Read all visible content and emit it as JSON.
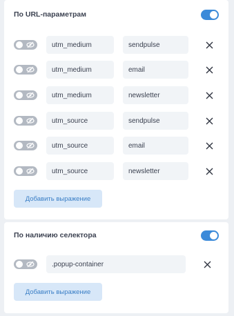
{
  "url_section": {
    "title": "По URL-параметрам",
    "enabled": true,
    "rules": [
      {
        "key": "utm_medium",
        "value": "sendpulse",
        "enabled": false
      },
      {
        "key": "utm_medium",
        "value": "email",
        "enabled": false
      },
      {
        "key": "utm_medium",
        "value": "newsletter",
        "enabled": false
      },
      {
        "key": "utm_source",
        "value": "sendpulse",
        "enabled": false
      },
      {
        "key": "utm_source",
        "value": "email",
        "enabled": false
      },
      {
        "key": "utm_source",
        "value": "newsletter",
        "enabled": false
      }
    ],
    "add_label": "Добавить выражение"
  },
  "selector_section": {
    "title": "По наличию селектора",
    "enabled": true,
    "rules": [
      {
        "selector": ".popup-container",
        "enabled": false
      }
    ],
    "add_label": "Добавить выражение"
  },
  "colors": {
    "accent": "#3b8ad9",
    "toggle_off": "#b3b9c2",
    "field_bg": "#f1f4f7",
    "button_bg": "#d7e7f8",
    "button_text": "#3b7fc6",
    "page_bg": "#edf0f4"
  },
  "icons": {
    "rule_toggle": "eye-off-icon",
    "remove": "close-icon"
  }
}
